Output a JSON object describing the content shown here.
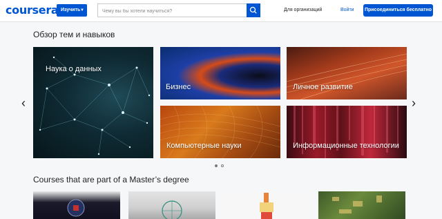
{
  "header": {
    "logo": "coursera",
    "explore_label": "Изучить",
    "search_placeholder": "Чему вы бы хотели научиться?",
    "for_orgs": "Для организаций",
    "login": "Войти",
    "join": "Присоединиться бесплатно"
  },
  "topics": {
    "title": "Обзор тем и навыков",
    "tiles": [
      {
        "label": "Наука о данных"
      },
      {
        "label": "Бизнес"
      },
      {
        "label": "Личное развитие"
      },
      {
        "label": "Компьютерные науки"
      },
      {
        "label": "Информационные технологии"
      }
    ],
    "prev_arrow": "‹",
    "next_arrow": "›",
    "carousel_page": 1,
    "carousel_pages": 2
  },
  "masters": {
    "title": "Courses that are part of a Master’s degree",
    "card_count": 4
  },
  "colors": {
    "brand": "#0056d2",
    "background": "#f5f7f8"
  }
}
